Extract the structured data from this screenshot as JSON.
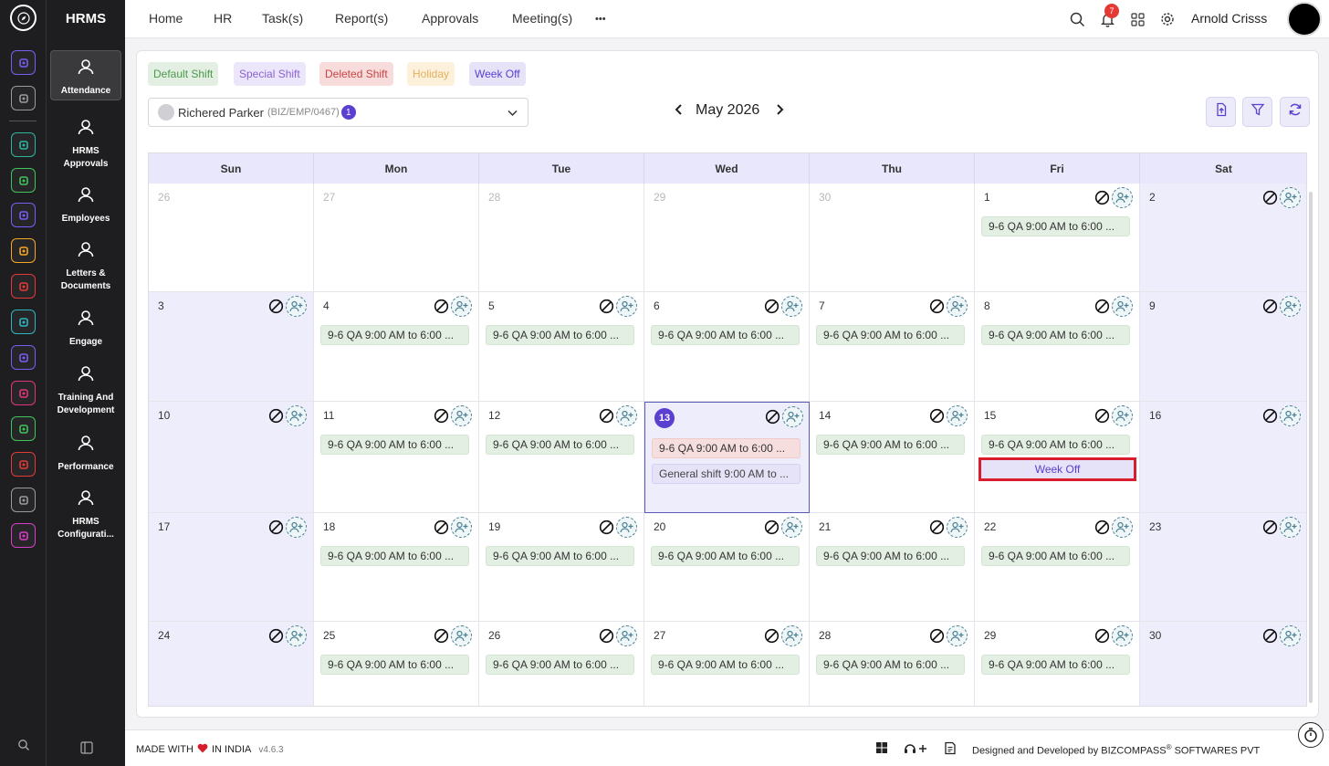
{
  "app": {
    "name": "HRMS"
  },
  "rail": {
    "icons": [
      {
        "name": "home-icon",
        "color": "#7b5cf5"
      },
      {
        "name": "pin-icon",
        "color": "#9a9a9a"
      },
      {
        "name": "people-tree-icon",
        "color": "#2eb5a0"
      },
      {
        "name": "stack-icon",
        "color": "#3ec45a"
      },
      {
        "name": "briefcase-icon",
        "color": "#7b5cf5"
      },
      {
        "name": "hrms-icon",
        "color": "#f5a623"
      },
      {
        "name": "target-icon",
        "color": "#e53935"
      },
      {
        "name": "archive-icon",
        "color": "#2eb5c0"
      },
      {
        "name": "flight-icon",
        "color": "#7b5cf5"
      },
      {
        "name": "monitor-icon",
        "color": "#e0357a"
      },
      {
        "name": "document-icon",
        "color": "#3ec45a"
      },
      {
        "name": "award-icon",
        "color": "#e53935"
      },
      {
        "name": "house-icon",
        "color": "#9a9a9a"
      },
      {
        "name": "settings-gear-icon",
        "color": "#d93cc8"
      }
    ]
  },
  "menu": {
    "items": [
      {
        "label": "Attendance",
        "icon": "attendance-icon",
        "active": true
      },
      {
        "label": "HRMS Approvals",
        "icon": "approvals-icon"
      },
      {
        "label": "Employees",
        "icon": "employees-icon"
      },
      {
        "label": "Letters & Documents",
        "icon": "letters-icon"
      },
      {
        "label": "Engage",
        "icon": "engage-icon"
      },
      {
        "label": "Training And Development",
        "icon": "training-icon"
      },
      {
        "label": "Performance",
        "icon": "performance-icon"
      },
      {
        "label": "HRMS Configurati...",
        "icon": "configuration-icon"
      }
    ]
  },
  "topnav": {
    "links": [
      "Home",
      "HR",
      "Task(s)",
      "Report(s)",
      "Approvals",
      "Meeting(s)"
    ],
    "more": "•••",
    "notifications": "7",
    "user": "Arnold Crisss"
  },
  "legend": [
    {
      "label": "Default Shift",
      "bg": "#e3efe2",
      "fg": "#4c9a4c"
    },
    {
      "label": "Special Shift",
      "bg": "#ece6fb",
      "fg": "#8a63d2"
    },
    {
      "label": "Deleted Shift",
      "bg": "#f8dcdc",
      "fg": "#c94545"
    },
    {
      "label": "Holiday",
      "bg": "#fdf1dc",
      "fg": "#e0b25c"
    },
    {
      "label": "Week Off",
      "bg": "#e6e2f8",
      "fg": "#5b3fd1"
    }
  ],
  "employee": {
    "name": "Richered Parker",
    "code": "(BIZ/EMP/0467)",
    "count": "1"
  },
  "calendar": {
    "month": "May 2026",
    "prev": "‹",
    "next": "›",
    "days": [
      "Sun",
      "Mon",
      "Tue",
      "Wed",
      "Thu",
      "Fri",
      "Sat"
    ],
    "shift_label": "9-6 QA 9:00 AM to 6:00 ...",
    "general_shift_label": "General shift 9:00 AM to ...",
    "week_off_label": "Week Off",
    "weeks": [
      [
        "26",
        "27",
        "28",
        "29",
        "30",
        "1",
        "2"
      ],
      [
        "3",
        "4",
        "5",
        "6",
        "7",
        "8",
        "9"
      ],
      [
        "10",
        "11",
        "12",
        "13",
        "14",
        "15",
        "16"
      ],
      [
        "17",
        "18",
        "19",
        "20",
        "21",
        "22",
        "23"
      ],
      [
        "24",
        "25",
        "26",
        "27",
        "28",
        "29",
        "30"
      ]
    ]
  },
  "footer": {
    "made_prefix": "MADE WITH",
    "made_suffix": "IN INDIA",
    "version": "v4.6.3",
    "designed": "Designed and Developed by",
    "brand": "BIZCOMPASS",
    "brand_mark": "®",
    "brand_suffix": "SOFTWARES PVT"
  }
}
